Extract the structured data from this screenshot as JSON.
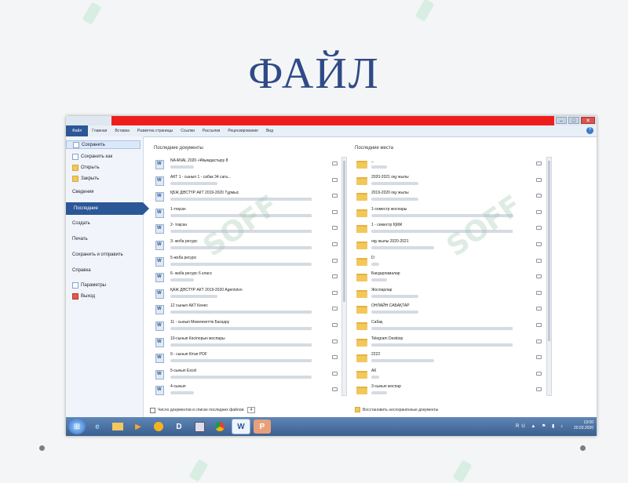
{
  "slide": {
    "title": "ФАЙЛ"
  },
  "window": {
    "title_text": ""
  },
  "ribbon_tabs": [
    "Файл",
    "Главная",
    "Вставка",
    "Разметка страницы",
    "Ссылки",
    "Рассылки",
    "Рецензирование",
    "Вид"
  ],
  "sidebar": {
    "top_items": [
      "Сохранить",
      "Сохранить как",
      "Открыть",
      "Закрыть"
    ],
    "sections": [
      "Сведения",
      "Последние",
      "Создать",
      "Печать",
      "Сохранить и отправить",
      "Справка"
    ],
    "bottom_items": [
      "Параметры",
      "Выход"
    ]
  },
  "recent_documents": {
    "heading": "Последние документы",
    "items": [
      "NA ANAL 2020 «Ұйымдастыру 8",
      "АКТ 1 - сынып 1 - сабак 34 сага...",
      "ҚБЖ ДӘСТҮР АКТ 2019-2020 Тұрмыс",
      "1-тоқсан",
      "2- тоқсан",
      "3- жоба ресурс",
      "5-жоба ресурс",
      "6- жаба ресурс 6 класс",
      "ҚАЖ ДӘСТҮР АКТ 2019-2020 Agentstvo",
      "12 сынып АКТ Кенес",
      "11 - сынып Мемлекеттік Басқару",
      "10-сынып Кәсіпорын жоспары",
      "9 - сынып Кітап PDF",
      "5-сынып Excel",
      "4-сынып"
    ],
    "footer": "Число документов в списке последних файлов:",
    "footer_count": "4"
  },
  "recent_places": {
    "heading": "Последние места",
    "items": [
      "_",
      "2020-2021 оқу жылы",
      "2019-2020 оқу жылы",
      "1-семестр жоспары",
      "1 - семестр ҚМЖ",
      "оқу жылы 2020-2021",
      "D:",
      "Бағдарламалар",
      "Жоспарлар",
      "ОНЛАЙН САБАҚТАР",
      "Сабақ",
      "Telegram Desktop",
      "2222",
      "АК",
      "3-сынып жоспар"
    ],
    "footer": "Восстановить несохранённые документы"
  },
  "taskbar": {
    "time": "13:00",
    "date": "20.03.2020",
    "lang": "RU"
  }
}
